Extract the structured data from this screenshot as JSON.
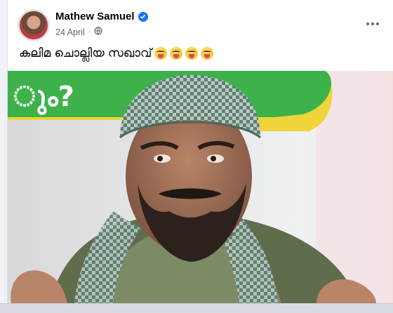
{
  "post": {
    "author": "Mathew Samuel",
    "date": "24 April",
    "caption": "കലിമ ചൊല്ലിയ സഖാവ്",
    "caption_emojis": [
      "winking-face-with-tongue",
      "winking-face-with-tongue",
      "winking-face-with-tongue",
      "winking-face-with-tongue"
    ],
    "banner_text": "ും?",
    "privacy": "public",
    "verified": true
  },
  "colors": {
    "verified_blue": "#1877f2",
    "banner_green": "#3db24a",
    "banner_yellow": "#f0d53a",
    "meta_gray": "#65676b"
  }
}
